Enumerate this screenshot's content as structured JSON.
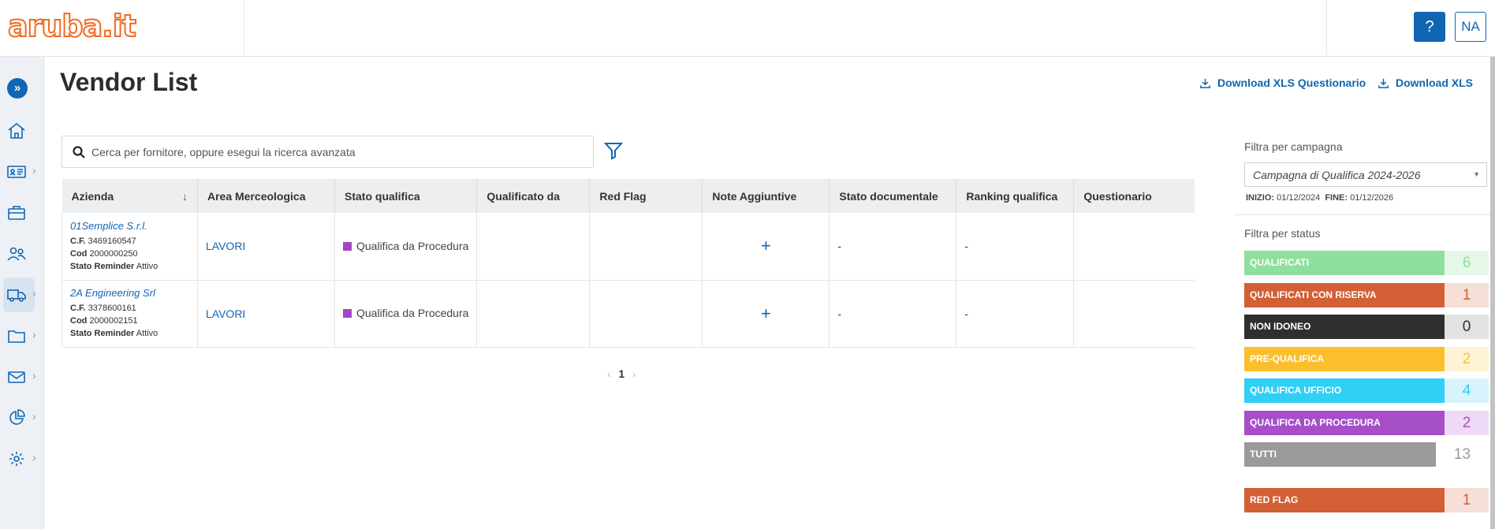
{
  "header": {
    "logo_text": "aruba.it",
    "help_label": "?",
    "user_initials": "NA"
  },
  "sidebar": {
    "expand_icon": "double-chevron-right-icon",
    "items": [
      {
        "icon": "home-icon",
        "has_submenu": false
      },
      {
        "icon": "id-card-icon",
        "has_submenu": true
      },
      {
        "icon": "briefcase-icon",
        "has_submenu": false
      },
      {
        "icon": "users-icon",
        "has_submenu": false
      },
      {
        "icon": "truck-icon",
        "has_submenu": true,
        "active": true
      },
      {
        "icon": "folder-icon",
        "has_submenu": true
      },
      {
        "icon": "mail-icon",
        "has_submenu": true
      },
      {
        "icon": "pie-chart-icon",
        "has_submenu": true
      },
      {
        "icon": "gear-icon",
        "has_submenu": true
      }
    ]
  },
  "main": {
    "title": "Vendor List",
    "download_questionario": "Download XLS Questionario",
    "download_xls": "Download XLS",
    "search_placeholder": "Cerca per fornitore, oppure esegui la ricerca avanzata",
    "columns": [
      "Azienda",
      "Area Merceologica",
      "Stato qualifica",
      "Qualificato da",
      "Red Flag",
      "Note Aggiuntive",
      "Stato documentale",
      "Ranking qualifica",
      "Questionario"
    ],
    "sort_indicator": "↓",
    "rows": [
      {
        "company": "01Semplice S.r.l.",
        "cf_label": "C.F.",
        "cf": "3469160547",
        "cod_label": "Cod",
        "cod": "2000000250",
        "reminder_label": "Stato Reminder",
        "reminder": "Attivo",
        "area": "LAVORI",
        "stato": "Qualifica da Procedura",
        "qualificato_da": "",
        "red_flag": "",
        "note": "+",
        "stato_documentale": "-",
        "ranking": "-",
        "questionario": ""
      },
      {
        "company": "2A Engineering Srl",
        "cf_label": "C.F.",
        "cf": "3378600161",
        "cod_label": "Cod",
        "cod": "2000002151",
        "reminder_label": "Stato Reminder",
        "reminder": "Attivo",
        "area": "LAVORI",
        "stato": "Qualifica da Procedura",
        "qualificato_da": "",
        "red_flag": "",
        "note": "+",
        "stato_documentale": "-",
        "ranking": "-",
        "questionario": ""
      }
    ],
    "pagination": {
      "prev": "‹",
      "current": "1",
      "next": "›"
    }
  },
  "filters": {
    "campaign_label": "Filtra per campagna",
    "campaign_value": "Campagna di Qualifica 2024-2026",
    "inizio_label": "INIZIO:",
    "inizio": "01/12/2024",
    "fine_label": "FINE:",
    "fine": "01/12/2026",
    "status_label": "Filtra per status",
    "statuses": [
      {
        "label": "QUALIFICATI",
        "count": "6",
        "color": "#8fdf9c",
        "count_color": "#8fdf9c",
        "count_bg": "#e6f7e9"
      },
      {
        "label": "QUALIFICATI CON RISERVA",
        "count": "1",
        "color": "#d35f35",
        "count_color": "#d35f35",
        "count_bg": "#f5dfd7"
      },
      {
        "label": "NON IDONEO",
        "count": "0",
        "color": "#2f2f2f",
        "count_color": "#2f2f2f",
        "count_bg": "#e2e2e2"
      },
      {
        "label": "PRE-QUALIFICA",
        "count": "2",
        "color": "#fbbf2e",
        "count_color": "#fbbf2e",
        "count_bg": "#fff3d6"
      },
      {
        "label": "QUALIFICA UFFICIO",
        "count": "4",
        "color": "#2fcff6",
        "count_color": "#2fcff6",
        "count_bg": "#d7f4fd"
      },
      {
        "label": "QUALIFICA DA PROCEDURA",
        "count": "2",
        "color": "#a64fc9",
        "count_color": "#a64fc9",
        "count_bg": "#eed9f6"
      },
      {
        "label": "TUTTI",
        "count": "13",
        "color": "#9a9a9a",
        "count_color": "#9a9a9a",
        "count_bg": "#ffffff"
      }
    ],
    "red_flag": {
      "label": "RED FLAG",
      "count": "1",
      "color": "#d35f35",
      "count_color": "#d35f35",
      "count_bg": "#f5dfd7"
    }
  }
}
